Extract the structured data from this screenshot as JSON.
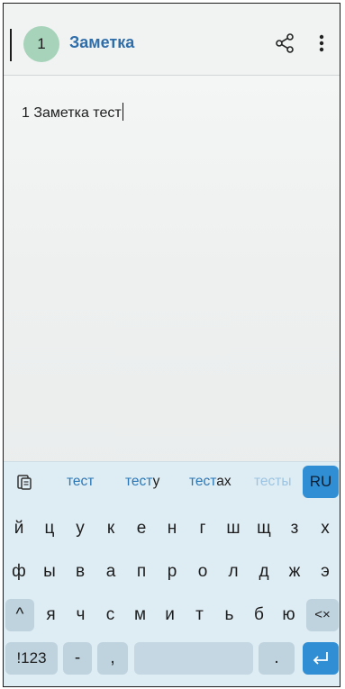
{
  "appbar": {
    "badge": "1",
    "title": "Заметка",
    "share_icon": "share-icon",
    "more_icon": "more-vert-icon"
  },
  "note": {
    "text": "1 Заметка тест"
  },
  "keyboard": {
    "suggestions": [
      {
        "typed": "тест",
        "rest": ""
      },
      {
        "typed": "тест",
        "rest": "у"
      },
      {
        "typed": "тест",
        "rest": "ах"
      },
      {
        "typed": "тесты",
        "rest": ""
      }
    ],
    "language": "RU",
    "row1": [
      "й",
      "ц",
      "у",
      "к",
      "е",
      "н",
      "г",
      "ш",
      "щ",
      "з",
      "х"
    ],
    "row2": [
      "ф",
      "ы",
      "в",
      "а",
      "п",
      "р",
      "о",
      "л",
      "д",
      "ж",
      "э"
    ],
    "row3": [
      "я",
      "ч",
      "с",
      "м",
      "и",
      "т",
      "ь",
      "б",
      "ю"
    ],
    "shift_symbol": "^",
    "backspace_symbol": "<×",
    "numbers_label": "!123",
    "dash_key": "-",
    "comma_key": ",",
    "period_key": ".",
    "enter_symbol": "↵",
    "accent_color": "#2f8ed4"
  }
}
